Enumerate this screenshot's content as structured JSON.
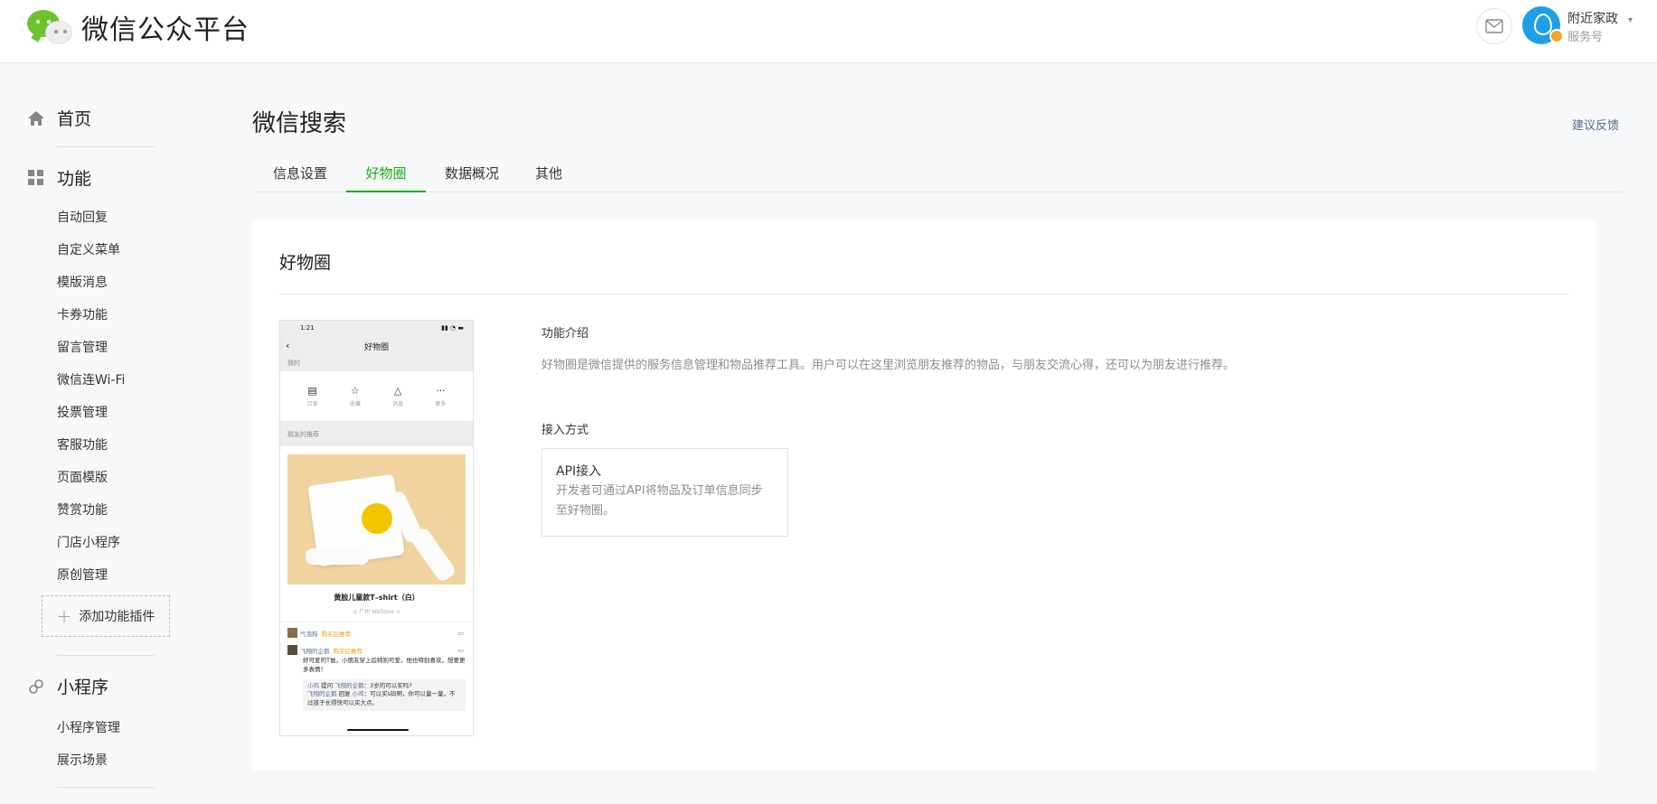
{
  "header": {
    "logo_text": "微信公众平台",
    "account_name": "附近家政",
    "account_type": "服务号",
    "account_caret": "▾"
  },
  "sidebar": {
    "home": "首页",
    "features": "功能",
    "feature_items": [
      "自动回复",
      "自定义菜单",
      "模版消息",
      "卡券功能",
      "留言管理",
      "微信连Wi-Fi",
      "投票管理",
      "客服功能",
      "页面模版",
      "赞赏功能",
      "门店小程序",
      "原创管理"
    ],
    "add_plugin": "添加功能插件",
    "mini_program": "小程序",
    "mini_items": [
      "小程序管理",
      "展示场景"
    ]
  },
  "main": {
    "title": "微信搜索",
    "feedback": "建议反馈",
    "tabs": [
      {
        "label": "信息设置",
        "active": false
      },
      {
        "label": "好物圈",
        "active": true
      },
      {
        "label": "数据概况",
        "active": false
      },
      {
        "label": "其他",
        "active": false
      }
    ],
    "card": {
      "title": "好物圈",
      "intro_label": "功能介绍",
      "intro_text": "好物圈是微信提供的服务信息管理和物品推荐工具。用户可以在这里浏览朋友推荐的物品，与朋友交流心得，还可以为朋友进行推荐。",
      "access_label": "接入方式",
      "api_title": "API接入",
      "api_desc": "开发者可通过API将物品及订单信息同步至好物圈。"
    }
  },
  "phone": {
    "time": "1:21",
    "status_icons": "▮▮ ◔ ▬",
    "nav_title": "好物圈",
    "my_label": "我的",
    "icons": [
      {
        "glyph": "▤",
        "label": "订单"
      },
      {
        "glyph": "☆",
        "label": "收藏"
      },
      {
        "glyph": "△",
        "label": "消息"
      },
      {
        "glyph": "···",
        "label": "更多"
      }
    ],
    "friends_label": "朋友的推荐",
    "product_name": "黄脸儿童款T–shirt（白）",
    "product_location": "◎ 广州 WeStore >",
    "rec1_name": "气泡狗",
    "rec1_tag": "购买后推荐",
    "rec2_name": "飞翔的企鹅",
    "rec2_tag": "购买后推荐",
    "rec2_text": "好可爱的T恤，小朋友穿上后特别可爱，他也特别喜欢，想要更多表情！",
    "reply1_a": "小鸡",
    "reply1_b": "提问",
    "reply1_c": "飞翔的企鹅",
    "reply1_d": "：3岁的可以买吗?",
    "reply2_a": "飞翔的企鹅",
    "reply2_b": "回复",
    "reply2_c": "小鸡",
    "reply2_d": "：可以买s码啊，你可以量一量，不过孩子长得快可以买大点。"
  },
  "colors": {
    "accent_green": "#1aad19",
    "link_blue": "#576b95"
  }
}
